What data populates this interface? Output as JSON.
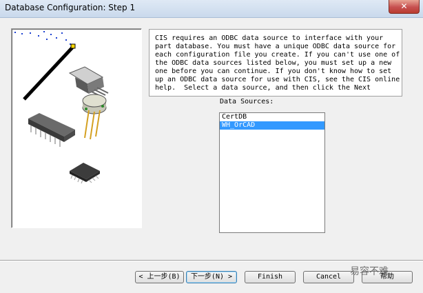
{
  "window": {
    "title": "Database Configuration: Step 1",
    "close_label": "✕"
  },
  "description": {
    "lines": [
      "CIS requires an ODBC data source to interface with your",
      "part database. You must have a unique ODBC data source for",
      "each configuration file you create. If you can't use one of",
      "the ODBC data sources listed below, you must set up a new",
      "one before you can continue. If you don't know how to set",
      "up an ODBC data source for use with CIS, see the CIS online",
      "help.  Select a data source, and then click the Next"
    ]
  },
  "data_sources": {
    "label": "Data Sources:",
    "items": [
      "CertDB",
      "WH_OrCAD"
    ],
    "selected_index": 1
  },
  "buttons": {
    "back": "< 上一步(B)",
    "next": "下一步(N) >",
    "finish": "Finish",
    "cancel": "Cancel",
    "help": "帮助"
  },
  "watermark": "易容不难",
  "colors": {
    "selection": "#3399ff",
    "title_bar": "#c9d9ec",
    "close_button": "#c75050"
  }
}
